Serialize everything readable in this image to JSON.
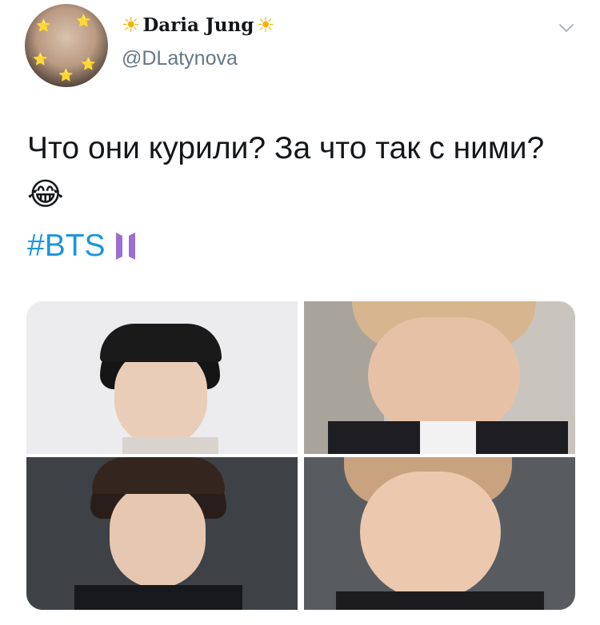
{
  "author": {
    "display_name": "Daria Jung",
    "name_emoji_left": "☀",
    "name_emoji_right": "☀",
    "handle": "@DLatynova",
    "avatar_icon": "avatar-photo"
  },
  "tweet": {
    "text": "Что они курили? За что так с ними?",
    "text_emoji": "😂",
    "hashtag": "#BTS",
    "hashtag_emoji": "bts-logo"
  },
  "menu": {
    "icon": "chevron-down-icon"
  },
  "media": {
    "count": 4,
    "items": [
      "photo-1",
      "photo-2",
      "photo-3",
      "photo-4"
    ]
  },
  "colors": {
    "text": "#14171a",
    "secondary": "#657786",
    "link": "#1b95e0",
    "bts_purple": "#9b6fd1"
  }
}
